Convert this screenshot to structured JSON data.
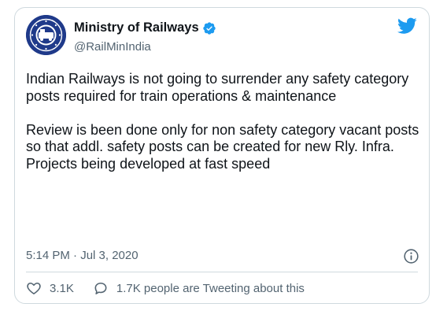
{
  "account": {
    "display_name": "Ministry of Railways",
    "handle": "@RailMinIndia",
    "verified": true
  },
  "tweet": {
    "paragraphs": [
      "Indian Railways is not going to surrender any safety category posts required for train operations & maintenance",
      "Review is been done only for non safety category vacant posts so that addl. safety posts can be created for new Rly. Infra. Projects being developed at fast speed"
    ],
    "timestamp": "5:14 PM · Jul 3, 2020"
  },
  "actions": {
    "likes": "3.1K",
    "tweeting": "1.7K people are Tweeting about this"
  },
  "icons": {
    "brand": "twitter-bird-icon",
    "verified": "verified-badge-icon",
    "info": "info-icon",
    "like": "heart-icon",
    "reply": "speech-bubble-icon"
  },
  "colors": {
    "twitter_blue": "#1d9bf0",
    "secondary_text": "#536471",
    "avatar_navy": "#1f3a8a"
  }
}
